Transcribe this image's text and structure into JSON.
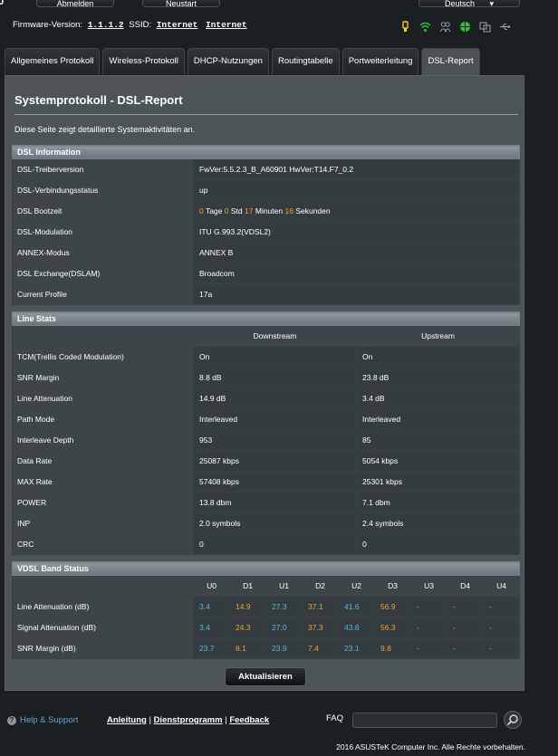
{
  "top": {
    "logout_label": "Abmelden",
    "reboot_label": "Neustart",
    "language_label": "Deutsch",
    "firmware_label": "Firmware-Version:",
    "firmware_value": "1.1.1.2",
    "ssid_label": "SSID:",
    "ssid_1": "Internet",
    "ssid_2": "Internet"
  },
  "tabs": [
    {
      "label": "Allgemeines Protokoll"
    },
    {
      "label": "Wireless-Protokoll"
    },
    {
      "label": "DHCP-Nutzungen"
    },
    {
      "label": "Routingtabelle"
    },
    {
      "label": "Portweiterleitung"
    },
    {
      "label": "DSL-Report"
    }
  ],
  "active_tab": "DSL-Report",
  "page": {
    "title": "Systemprotokoll - DSL-Report",
    "description": "Diese Seite zeigt detaillierte Systemaktivitäten an."
  },
  "dsl_info": {
    "heading": "DSL Information",
    "rows": [
      {
        "label": "DSL-Treiberversion",
        "value": "FwVer:5.5.2.3_B_A60901 HwVer:T14.F7_0.2"
      },
      {
        "label": "DSL-Verbindungsstatus",
        "value": "up"
      },
      {
        "label": "DSL Bootzeit",
        "value": ""
      },
      {
        "label": "DSL-Modulation",
        "value": "ITU G.993.2(VDSL2)"
      },
      {
        "label": "ANNEX-Modus",
        "value": "ANNEX B"
      },
      {
        "label": "DSL Exchange(DSLAM)",
        "value": "Broadcom"
      },
      {
        "label": "Current Profile",
        "value": "17a"
      }
    ],
    "uptime": {
      "days": "0",
      "days_unit": "Tage",
      "hours": "0",
      "hours_unit": "Std",
      "minutes": "17",
      "minutes_unit": "Minuten",
      "seconds": "16",
      "seconds_unit": "Sekunden"
    }
  },
  "line_stats": {
    "heading": "Line Stats",
    "col_down": "Downstream",
    "col_up": "Upstream",
    "rows": [
      {
        "label": "TCM(Trellis Coded Modulation)",
        "down": "On",
        "up": "On"
      },
      {
        "label": "SNR Margin",
        "down": "8.8 dB",
        "up": "23.8 dB"
      },
      {
        "label": "Line Attenuation",
        "down": "14.9 dB",
        "up": "3.4 dB"
      },
      {
        "label": "Path Mode",
        "down": "Interleaved",
        "up": "Interleaved"
      },
      {
        "label": "Interleave Depth",
        "down": "953",
        "up": "85"
      },
      {
        "label": "Data Rate",
        "down": "25087 kbps",
        "up": "5054 kbps"
      },
      {
        "label": "MAX Rate",
        "down": "57408 kbps",
        "up": "25301 kbps"
      },
      {
        "label": "POWER",
        "down": "13.8 dbm",
        "up": "7.1 dbm"
      },
      {
        "label": "INP",
        "down": "2.0 symbols",
        "up": "2.4 symbols"
      },
      {
        "label": "CRC",
        "down": "0",
        "up": "0"
      }
    ]
  },
  "vdsl_band": {
    "heading": "VDSL Band Status",
    "columns": [
      "U0",
      "D1",
      "U1",
      "D2",
      "U2",
      "D3",
      "U3",
      "D4",
      "U4"
    ],
    "rows": [
      {
        "label": "Line Attenuation (dB)",
        "values": [
          "3.4",
          "14.9",
          "27.3",
          "37.1",
          "41.6",
          "56.9",
          "-",
          "-",
          "-"
        ]
      },
      {
        "label": "Signal Attenuation (dB)",
        "values": [
          "3.4",
          "24.3",
          "27.0",
          "37.3",
          "43.8",
          "56.3",
          "-",
          "-",
          "-"
        ]
      },
      {
        "label": "SNR Margin (dB)",
        "values": [
          "23.7",
          "8.1",
          "23.9",
          "7.4",
          "23.1",
          "9.8",
          "-",
          "-",
          "-"
        ]
      }
    ],
    "upstream_color": "#4fb8e8",
    "downstream_color": "#f0a030"
  },
  "update_button": "Aktualisieren",
  "footer": {
    "help": "Help & Support",
    "link_1": "Anleitung",
    "link_2": "Dienstprogramm",
    "link_3": "Feedback",
    "separator": "|",
    "faq_label": "FAQ",
    "copyright": "2016 ASUSTeK Computer Inc. Alle Rechte vorbehalten."
  }
}
